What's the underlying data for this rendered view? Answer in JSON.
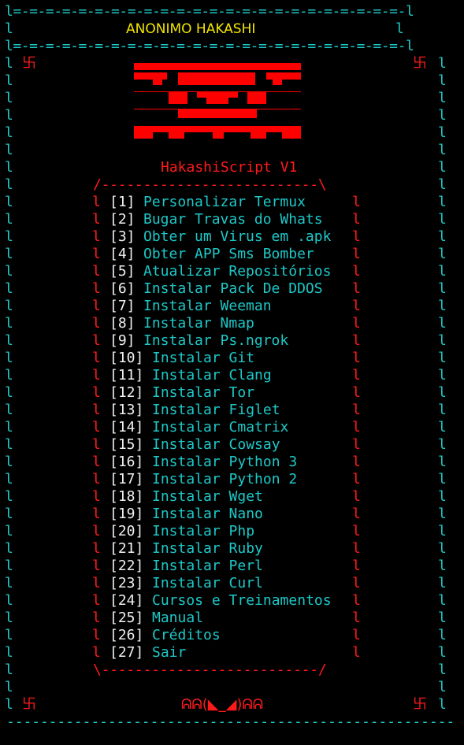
{
  "header": {
    "top_border": "l=-=-=-=-=-=-=-=-=-=-=-=-=-=-=-=-=-=-=-=-=-=-=-=-l",
    "title": "ANONIMO HAKASHI",
    "side_char": "l",
    "bottom_border": "l=-=-=-=-=-=-=-=-=-=-=-=-=-=-=-=-=-=-=-=-=-=-=-=-l"
  },
  "symbols": {
    "corner_symbol": "卐",
    "footer_emblem": "ᕱᕱ(◣_◢)ᕱᕱ"
  },
  "script_title": "HakashiScript V1",
  "menu_top_border": "/--------------------------\\",
  "menu_bottom_border": "\\--------------------------/",
  "menu_border_char": "l",
  "menu": [
    {
      "num": "[1]",
      "label": "Personalizar Termux"
    },
    {
      "num": "[2]",
      "label": "Bugar Travas do Whats"
    },
    {
      "num": "[3]",
      "label": "Obter um Virus em .apk"
    },
    {
      "num": "[4]",
      "label": "Obter APP Sms Bomber"
    },
    {
      "num": "[5]",
      "label": "Atualizar Repositórios"
    },
    {
      "num": "[6]",
      "label": "Instalar Pack De DDOS"
    },
    {
      "num": "[7]",
      "label": "Instalar Weeman"
    },
    {
      "num": "[8]",
      "label": "Instalar Nmap"
    },
    {
      "num": "[9]",
      "label": "Instalar Ps.ngrok"
    },
    {
      "num": "[10]",
      "label": "Instalar Git"
    },
    {
      "num": "[11]",
      "label": "Instalar Clang"
    },
    {
      "num": "[12]",
      "label": "Instalar Tor"
    },
    {
      "num": "[13]",
      "label": "Instalar Figlet"
    },
    {
      "num": "[14]",
      "label": "Instalar Cmatrix"
    },
    {
      "num": "[15]",
      "label": "Instalar Cowsay"
    },
    {
      "num": "[16]",
      "label": "Instalar Python 3"
    },
    {
      "num": "[17]",
      "label": "Instalar Python 2"
    },
    {
      "num": "[18]",
      "label": "Instalar Wget"
    },
    {
      "num": "[19]",
      "label": "Instalar Nano"
    },
    {
      "num": "[20]",
      "label": "Instalar Php"
    },
    {
      "num": "[21]",
      "label": "Instalar Ruby"
    },
    {
      "num": "[22]",
      "label": "Instalar Perl"
    },
    {
      "num": "[23]",
      "label": "Instalar Curl"
    },
    {
      "num": "[24]",
      "label": "Cursos e Treinamentos"
    },
    {
      "num": "[25]",
      "label": "Manual"
    },
    {
      "num": "[26]",
      "label": "Créditos"
    },
    {
      "num": "[27]",
      "label": "Sair"
    }
  ],
  "footer_dashes": "-----------------------------------------------------",
  "colors": {
    "cyan": "#1ec8c8",
    "yellow": "#f2e600",
    "red": "#ff1a1a",
    "white": "#f0f0f0"
  }
}
